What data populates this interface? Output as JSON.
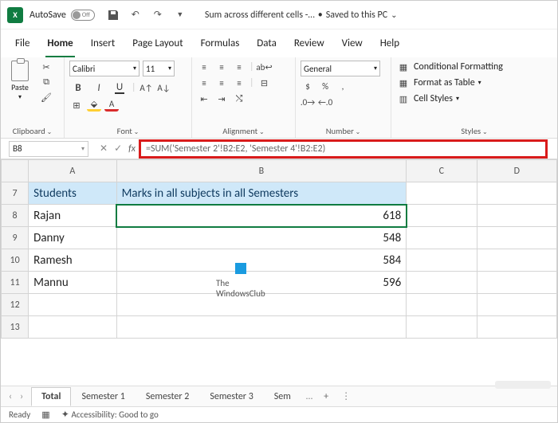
{
  "title_bar": {
    "autosave_label": "AutoSave",
    "autosave_state": "Off",
    "file_name": "Sum across different cells -…",
    "save_status": "Saved to this PC"
  },
  "menu_tabs": [
    "File",
    "Home",
    "Insert",
    "Page Layout",
    "Formulas",
    "Data",
    "Review",
    "View",
    "Help"
  ],
  "menu_active": 1,
  "ribbon": {
    "clipboard": {
      "paste": "Paste",
      "label": "Clipboard"
    },
    "font": {
      "name": "Calibri",
      "size": "11",
      "label": "Font"
    },
    "alignment": {
      "label": "Alignment"
    },
    "number": {
      "format": "General",
      "label": "Number"
    },
    "styles": {
      "cond": "Conditional Formatting",
      "table": "Format as Table",
      "cell": "Cell Styles",
      "label": "Styles"
    }
  },
  "name_box": "B8",
  "formula": "=SUM('Semester 2'!B2:E2, 'Semester 4'!B2:E2)",
  "grid": {
    "cols": [
      "A",
      "B",
      "C",
      "D"
    ],
    "row_headers": [
      "7",
      "8",
      "9",
      "10",
      "11",
      "12",
      "13"
    ],
    "header_row": {
      "A": "Students",
      "B": "Marks in all subjects in all Semesters"
    },
    "data_rows": [
      {
        "A": "Rajan",
        "B": "618"
      },
      {
        "A": "Danny",
        "B": "548"
      },
      {
        "A": "Ramesh",
        "B": "584"
      },
      {
        "A": "Mannu",
        "B": "596"
      }
    ]
  },
  "watermark": {
    "line1": "The",
    "line2": "WindowsClub"
  },
  "sheet_tabs": [
    "Total",
    "Semester 1",
    "Semester 2",
    "Semester 3",
    "Sem"
  ],
  "sheet_active": 0,
  "status": {
    "ready": "Ready",
    "accessibility": "Accessibility: Good to go"
  }
}
